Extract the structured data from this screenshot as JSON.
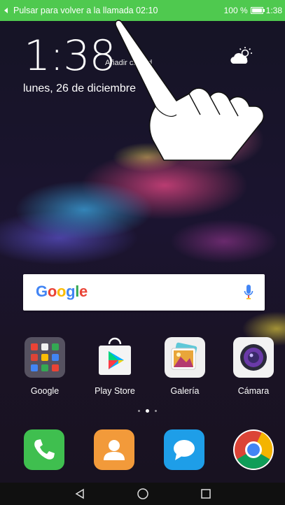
{
  "status_bar": {
    "call_banner": "Pulsar para volver a la llamada",
    "call_time": "02:10",
    "battery_percent": "100 %",
    "clock": "1:38",
    "color": "#4fc94f"
  },
  "lockscreen_widget": {
    "time": "1:38",
    "add_city": "Añadir ciudad",
    "date": "lunes, 26 de diciembre",
    "weather_icon": "partly-cloudy-icon"
  },
  "search": {
    "logo_text": "Google",
    "mic_icon": "mic-icon"
  },
  "apps": [
    {
      "label": "Google",
      "icon": "google-folder-icon"
    },
    {
      "label": "Play Store",
      "icon": "play-store-icon"
    },
    {
      "label": "Galería",
      "icon": "gallery-icon"
    },
    {
      "label": "Cámara",
      "icon": "camera-icon"
    }
  ],
  "page_indicator": {
    "count": 3,
    "active": 2
  },
  "dock": [
    {
      "icon": "phone-icon"
    },
    {
      "icon": "contacts-icon"
    },
    {
      "icon": "messages-icon"
    },
    {
      "icon": "chrome-icon"
    }
  ],
  "navbar": {
    "back": "back-icon",
    "home": "home-icon",
    "recents": "recents-icon"
  }
}
